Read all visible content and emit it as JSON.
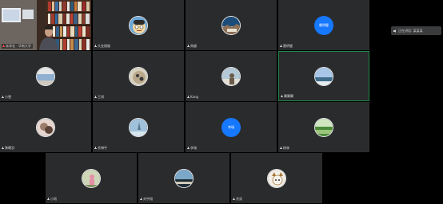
{
  "side_panel": {
    "speaking_label": "正在讲话: 某某某"
  },
  "host": {
    "name": "未命名 · 华南大学"
  },
  "tiles": [
    {
      "name": "大金刚猴",
      "avatar_type": "photo",
      "palette": [
        "#f5d7a0",
        "#6aa7d8",
        "#2b2b2b"
      ]
    },
    {
      "name": "周越",
      "avatar_type": "photo",
      "palette": [
        "#c9b39a",
        "#1c4d7a",
        "#e9e2d0"
      ]
    },
    {
      "name": "雷明健",
      "avatar_type": "text",
      "avatar_text": "雷明健"
    },
    {
      "name": "小雪",
      "avatar_type": "photo",
      "palette": [
        "#e6e6e6",
        "#8fb0d0",
        "#cfc9bd"
      ]
    },
    {
      "name": "王琪",
      "avatar_type": "photo",
      "palette": [
        "#b9a88c",
        "#3a3a3a",
        "#d9d2c0"
      ]
    },
    {
      "name": "Kang",
      "avatar_type": "photo",
      "palette": [
        "#b4c9d8",
        "#6b5a48",
        "#e4e0d6"
      ]
    },
    {
      "name": "翼翼翼",
      "avatar_type": "photo",
      "palette": [
        "#a8c6e8",
        "#3f6c8a",
        "#e7ecef"
      ]
    },
    {
      "name": "黎曦羽",
      "avatar_type": "photo",
      "palette": [
        "#9b7d6a",
        "#e6d5cf",
        "#5a4336"
      ]
    },
    {
      "name": "余博宇",
      "avatar_type": "photo",
      "palette": [
        "#9fc1dc",
        "#d9e5ee",
        "#5d7b92"
      ]
    },
    {
      "name": "李瑞",
      "avatar_type": "text",
      "avatar_text": "李瑞"
    },
    {
      "name": "杨林",
      "avatar_type": "photo",
      "palette": [
        "#4b8a3a",
        "#9bc57a",
        "#cfe6c0"
      ]
    },
    {
      "name": "小雨",
      "avatar_type": "photo",
      "palette": [
        "#cdd7b8",
        "#e48fa5",
        "#7b8f5a"
      ]
    },
    {
      "name": "刘宇翔",
      "avatar_type": "photo",
      "palette": [
        "#7ba7c9",
        "#1c2a33",
        "#d0c9b8"
      ]
    },
    {
      "name": "余双",
      "avatar_type": "photo",
      "palette": [
        "#f2eee7",
        "#a57a3b",
        "#2d2a25"
      ]
    }
  ],
  "colors": {
    "background": "#000000",
    "tile": "#2a2b2d",
    "active_border": "#1f8a4a",
    "avatar_text_bg": "#1677ff"
  }
}
